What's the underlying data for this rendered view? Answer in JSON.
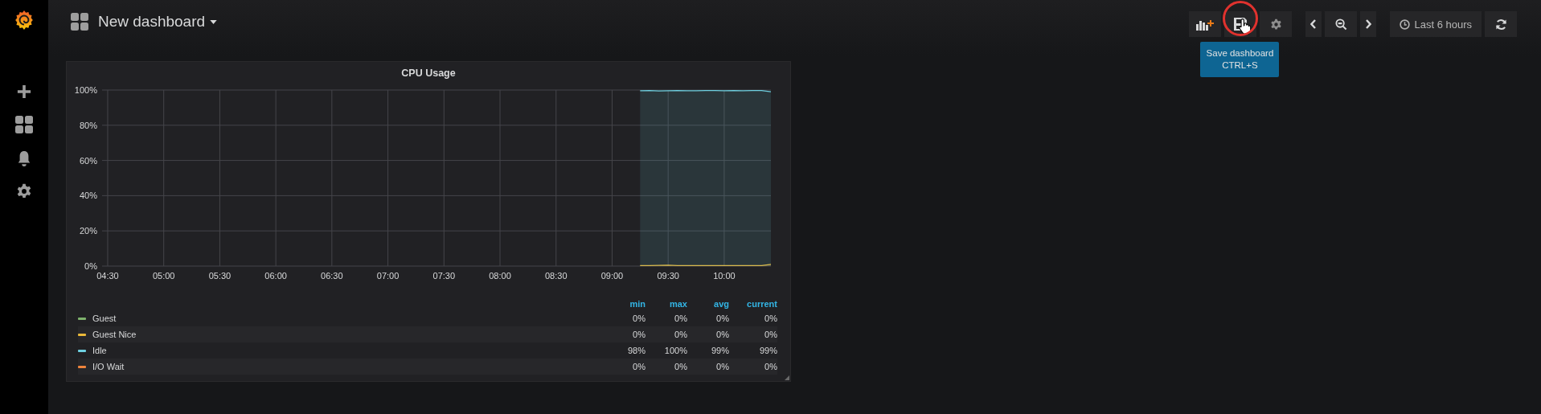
{
  "header": {
    "title": "New dashboard"
  },
  "toolbar": {
    "time_range": "Last 6 hours",
    "tooltip": {
      "title": "Save dashboard",
      "shortcut": "CTRL+S"
    }
  },
  "panel": {
    "title": "CPU Usage",
    "chart_data": {
      "type": "area",
      "grid": true,
      "xlim": [
        267,
        625
      ],
      "ylim": [
        0,
        100
      ],
      "xticks": [
        {
          "value": 270,
          "label": "04:30"
        },
        {
          "value": 300,
          "label": "05:00"
        },
        {
          "value": 330,
          "label": "05:30"
        },
        {
          "value": 360,
          "label": "06:00"
        },
        {
          "value": 390,
          "label": "06:30"
        },
        {
          "value": 420,
          "label": "07:00"
        },
        {
          "value": 450,
          "label": "07:30"
        },
        {
          "value": 480,
          "label": "08:00"
        },
        {
          "value": 510,
          "label": "08:30"
        },
        {
          "value": 540,
          "label": "09:00"
        },
        {
          "value": 570,
          "label": "09:30"
        },
        {
          "value": 600,
          "label": "10:00"
        }
      ],
      "yticks": [
        {
          "value": 0,
          "label": "0%"
        },
        {
          "value": 20,
          "label": "20%"
        },
        {
          "value": 40,
          "label": "40%"
        },
        {
          "value": 60,
          "label": "60%"
        },
        {
          "value": 80,
          "label": "80%"
        },
        {
          "value": 100,
          "label": "100%"
        }
      ],
      "x": [
        555,
        560,
        565,
        570,
        575,
        580,
        585,
        590,
        595,
        600,
        605,
        610,
        615,
        620,
        625
      ],
      "series": [
        {
          "color": "#eab839",
          "values": [
            0.3,
            0.3,
            0.4,
            0.5,
            0.3,
            0.3,
            0.3,
            0.3,
            0.3,
            0.3,
            0.3,
            0.3,
            0.3,
            0.3,
            1
          ]
        },
        {
          "color": "#6ed0e0",
          "values": [
            99.6,
            99.7,
            99.5,
            99.6,
            99.7,
            99.6,
            99.6,
            99.7,
            99.7,
            99.6,
            99.7,
            99.6,
            99.7,
            99.7,
            99
          ]
        }
      ]
    },
    "legend": {
      "columns": [
        "min",
        "max",
        "avg",
        "current"
      ],
      "rows": [
        {
          "name": "Guest",
          "color": "#7eb26d",
          "values": [
            "0%",
            "0%",
            "0%",
            "0%"
          ]
        },
        {
          "name": "Guest Nice",
          "color": "#eab839",
          "values": [
            "0%",
            "0%",
            "0%",
            "0%"
          ]
        },
        {
          "name": "Idle",
          "color": "#6ed0e0",
          "values": [
            "98%",
            "100%",
            "99%",
            "99%"
          ]
        },
        {
          "name": "I/O Wait",
          "color": "#ef843c",
          "values": [
            "0%",
            "0%",
            "0%",
            "0%"
          ]
        }
      ]
    }
  }
}
